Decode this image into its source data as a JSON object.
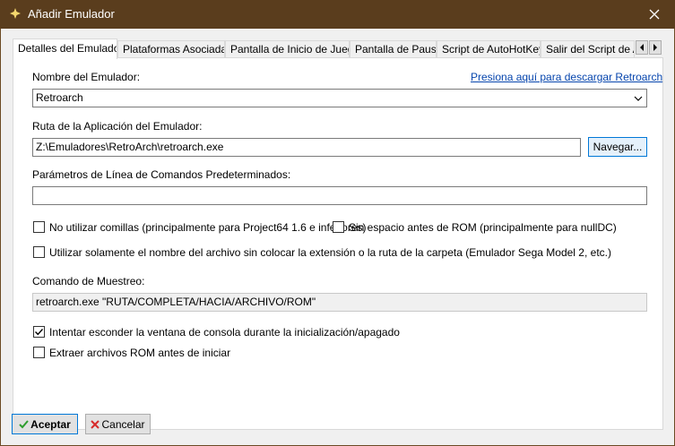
{
  "window": {
    "title": "Añadir Emulador",
    "titlebar_color": "#5a3d1d"
  },
  "tabs": [
    {
      "label": "Detalles del Emulador",
      "active": true
    },
    {
      "label": "Plataformas Asociadas",
      "active": false
    },
    {
      "label": "Pantalla de Inicio de Juego",
      "active": false
    },
    {
      "label": "Pantalla de Pausa",
      "active": false
    },
    {
      "label": "Script de AutoHotKey",
      "active": false
    },
    {
      "label": "Salir del Script de AutoHotKey",
      "active": false
    }
  ],
  "form": {
    "emulator_name_label": "Nombre del Emulador:",
    "download_link": "Presiona aquí para descargar Retroarch",
    "emulator_name_value": "Retroarch",
    "app_path_label": "Ruta de la Aplicación del Emulador:",
    "app_path_value": "Z:\\Emuladores\\RetroArch\\retroarch.exe",
    "browse_button": "Navegar...",
    "cmdline_label": "Parámetros de Línea de Comandos Predeterminados:",
    "cmdline_value": "",
    "no_quotes_label": "No utilizar comillas (principalmente para Project64 1.6 e inferiores)",
    "no_quotes_checked": false,
    "no_space_label": "Sin espacio antes de ROM (principalmente para nullDC)",
    "no_space_checked": false,
    "filename_only_label": "Utilizar solamente el nombre del archivo sin colocar la extensión o la ruta de la carpeta  (Emulador Sega Model 2, etc.)",
    "filename_only_checked": false,
    "sample_command_label": "Comando de Muestreo:",
    "sample_command_value": "retroarch.exe \"RUTA/COMPLETA/HACIA/ARCHIVO/ROM\"",
    "hide_console_label": "Intentar esconder la ventana de consola durante la inicialización/apagado",
    "hide_console_checked": true,
    "extract_rom_label": "Extraer archivos ROM antes de iniciar",
    "extract_rom_checked": false
  },
  "footer": {
    "accept_button": "Aceptar",
    "cancel_button": "Cancelar"
  }
}
